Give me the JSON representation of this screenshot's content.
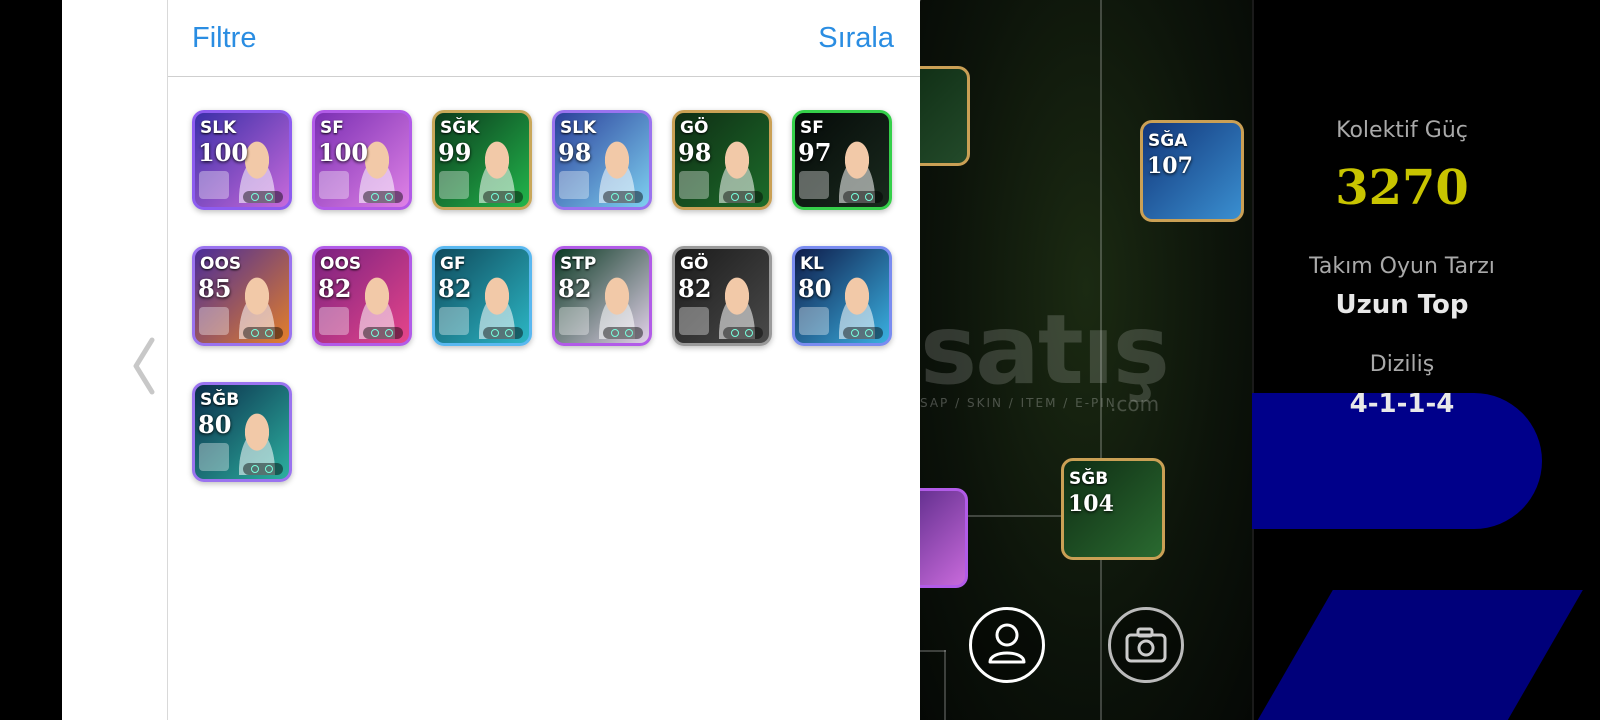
{
  "header": {
    "filter_label": "Filtre",
    "sort_label": "Sırala"
  },
  "cards": [
    {
      "position": "SLK",
      "rating": "100",
      "border": "#8d5cf0",
      "bg": [
        "#3a2fa8",
        "#c86adb"
      ]
    },
    {
      "position": "SF",
      "rating": "100",
      "border": "#b25be8",
      "bg": [
        "#7a2fb3",
        "#e082e6"
      ]
    },
    {
      "position": "SĞK",
      "rating": "99",
      "border": "#c9a75a",
      "bg": [
        "#0c3a1c",
        "#22b64c"
      ]
    },
    {
      "position": "SLK",
      "rating": "98",
      "border": "#9a73ef",
      "bg": [
        "#2b3f9a",
        "#7ed0f0"
      ]
    },
    {
      "position": "GÖ",
      "rating": "98",
      "border": "#caa055",
      "bg": [
        "#0f2d14",
        "#1c6c2a"
      ]
    },
    {
      "position": "SF",
      "rating": "97",
      "border": "#35d04a",
      "bg": [
        "#050a08",
        "#1a2a1e"
      ]
    },
    {
      "position": "OOS",
      "rating": "85",
      "border": "#9a73ef",
      "bg": [
        "#4a2c98",
        "#e37f2a"
      ]
    },
    {
      "position": "OOS",
      "rating": "82",
      "border": "#b25be8",
      "bg": [
        "#7a2180",
        "#e6458a"
      ]
    },
    {
      "position": "GF",
      "rating": "82",
      "border": "#5ab8f0",
      "bg": [
        "#0f4a5c",
        "#2cb6c4"
      ]
    },
    {
      "position": "STP",
      "rating": "82",
      "border": "#b25be8",
      "bg": [
        "#0c3a24",
        "#e1d1e8"
      ]
    },
    {
      "position": "GÖ",
      "rating": "82",
      "border": "#9a9a9a",
      "bg": [
        "#1b1b1b",
        "#4a4a4a"
      ]
    },
    {
      "position": "KL",
      "rating": "80",
      "border": "#7a8cf0",
      "bg": [
        "#0e1b4a",
        "#3ab0e0"
      ]
    },
    {
      "position": "SĞB",
      "rating": "80",
      "border": "#9a73ef",
      "bg": [
        "#0b2d4a",
        "#2cb0a0"
      ]
    }
  ],
  "pitch": {
    "watermark": {
      "main": "satış",
      "sub": "SAP / SKIN / ITEM / E-PIN",
      "suffix": ".com"
    },
    "players": [
      {
        "position": "SĞA",
        "rating": "107"
      },
      {
        "position": "SĞB",
        "rating": "104"
      }
    ],
    "icons": {
      "profile": "user-icon",
      "camera": "camera-icon"
    }
  },
  "stats": {
    "power_label": "Kolektif Güç",
    "power_value": "3270",
    "style_label": "Takım Oyun Tarzı",
    "style_value": "Uzun Top",
    "formation_label": "Diziliş",
    "formation_value": "4-1-1-4"
  },
  "colors": {
    "accent": "#2a8de2",
    "power": "#c8c400"
  }
}
